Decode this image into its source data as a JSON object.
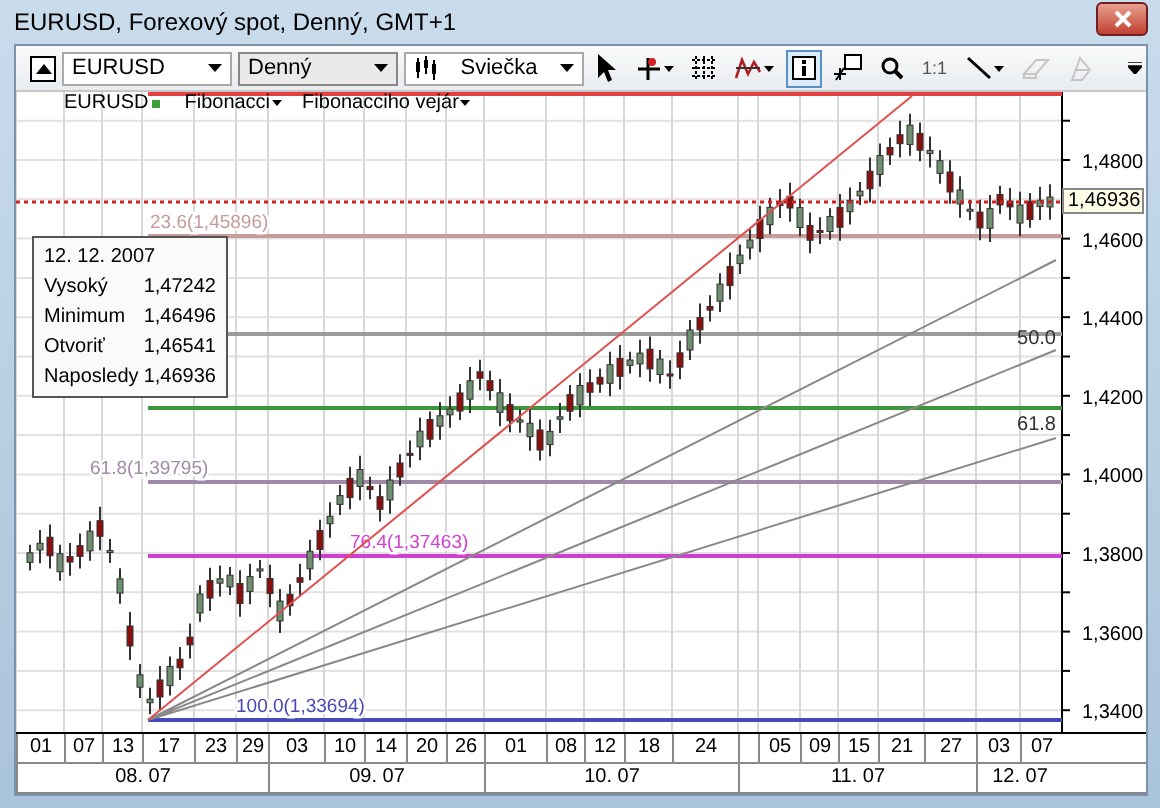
{
  "window": {
    "title": "EURUSD, Forexový spot, Denný, GMT+1"
  },
  "toolbar": {
    "symbol": "EURUSD",
    "period": "Denný",
    "chart_type": "Sviečka",
    "tools": [
      {
        "kind": "pointer",
        "selected": false,
        "disabled": false,
        "dropdown": false
      },
      {
        "kind": "crosshair",
        "selected": false,
        "disabled": false,
        "dropdown": true
      },
      {
        "kind": "grid",
        "selected": false,
        "disabled": false,
        "dropdown": false
      },
      {
        "kind": "indicator",
        "selected": false,
        "disabled": false,
        "dropdown": true
      },
      {
        "kind": "info",
        "selected": true,
        "disabled": false,
        "dropdown": false
      },
      {
        "kind": "annotation",
        "selected": false,
        "disabled": false,
        "dropdown": false
      },
      {
        "kind": "zoom",
        "selected": false,
        "disabled": false,
        "dropdown": false
      },
      {
        "kind": "ratio",
        "label": "1:1",
        "selected": false,
        "disabled": false,
        "dropdown": false
      },
      {
        "kind": "line",
        "selected": false,
        "disabled": false,
        "dropdown": true
      },
      {
        "kind": "eraser",
        "selected": false,
        "disabled": true,
        "dropdown": false
      },
      {
        "kind": "shapes",
        "selected": false,
        "disabled": true,
        "dropdown": false
      }
    ]
  },
  "chart": {
    "legend": [
      {
        "label": "EURUSD",
        "dropdown": false
      },
      {
        "label": "Fibonacci",
        "dropdown": true
      },
      {
        "label": "Fibonacciho vejár",
        "dropdown": true
      }
    ],
    "fib_lines": [
      {
        "color": "#e04040"
      },
      {
        "label": "23.6(1,45896)",
        "color": "#c89a9a"
      },
      {
        "color": "#9a9a9a"
      },
      {
        "color": "#3c963c"
      },
      {
        "label": "61.8(1,39795)",
        "color": "#a08aa8"
      },
      {
        "label": "76.4(1,37463)",
        "color": "#d040d0"
      },
      {
        "label": "100.0(1,33694)",
        "color": "#4848b8"
      }
    ],
    "fan_labels": [
      "50.0",
      "61.8"
    ],
    "price_axis": [
      "1,4800",
      "1,4600",
      "1,4400",
      "1,4200",
      "1,4000",
      "1,3800",
      "1,3600",
      "1,3400"
    ],
    "current_price": "1,46936",
    "tooltip": {
      "date": "12. 12. 2007",
      "rows": [
        {
          "name": "Vysoký",
          "value": "1,47242"
        },
        {
          "name": "Minimum",
          "value": "1,46496"
        },
        {
          "name": "Otvoriť",
          "value": "1,46541"
        },
        {
          "name": "Naposledy",
          "value": "1,46936"
        }
      ]
    },
    "days": [
      "01",
      "07",
      "13",
      "17",
      "23",
      "29",
      "03",
      "10",
      "14",
      "20",
      "26",
      "01",
      "08",
      "12",
      "18",
      "24",
      "05",
      "09",
      "15",
      "21",
      "27",
      "03",
      "07"
    ],
    "months": [
      "08. 07",
      "09. 07",
      "10. 07",
      "11. 07",
      "12. 07"
    ]
  }
}
